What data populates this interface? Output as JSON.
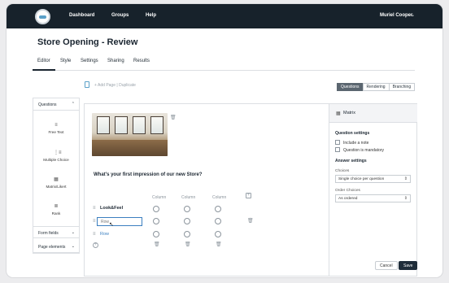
{
  "nav": {
    "links": [
      "Dashboard",
      "Groups",
      "Help"
    ],
    "user_name": "Muriel Cooper",
    "user_caret": "⌄"
  },
  "page": {
    "title": "Store Opening - Review",
    "tabs": [
      "Editor",
      "Style",
      "Settings",
      "Sharing",
      "Results"
    ],
    "active_tab": "Editor"
  },
  "toolbar": {
    "add_page": "+ Add Page",
    "separator": "|",
    "duplicate": "Duplicate",
    "view_tabs": [
      "Questions",
      "Rendering",
      "Branching"
    ],
    "active_view": "Questions"
  },
  "left_panel": {
    "questions_header": "Questions",
    "items": [
      {
        "label": "Free Text",
        "icon": "free-text-icon",
        "glyph": "≡"
      },
      {
        "label": "Multiple Choice",
        "icon": "multiple-choice-icon",
        "glyph": "⋮≡"
      },
      {
        "label": "Matrix/Likert",
        "icon": "matrix-icon",
        "glyph": "▦"
      },
      {
        "label": "Rank",
        "icon": "rank-icon",
        "glyph": "≣"
      }
    ],
    "form_fields_header": "Form fields",
    "page_elements_header": "Page elements"
  },
  "canvas": {
    "question_text": "What's your first impression of our new Store?",
    "columns": [
      "Column",
      "Column",
      "Column"
    ],
    "rows": [
      {
        "label": "Look&Feel"
      },
      {
        "label": "",
        "placeholder": "Row"
      },
      {
        "label": "Row"
      }
    ],
    "add_col_glyph": "+",
    "add_row_glyph": "+"
  },
  "right_panel": {
    "title": "Matrix",
    "question_settings_header": "Question settings",
    "include_note_label": "Include a note",
    "mandatory_label": "Question is mandatory",
    "answer_settings_header": "Answer settings",
    "choices_label": "Choices",
    "choices_value": "Single choice per question",
    "order_label": "Order Choices",
    "order_value": "As ordered",
    "cancel_label": "Cancel",
    "save_label": "Save"
  },
  "colors": {
    "nav_bg": "#17222b",
    "accent": "#3b7fc0",
    "save_bg": "#1f2d3a"
  }
}
